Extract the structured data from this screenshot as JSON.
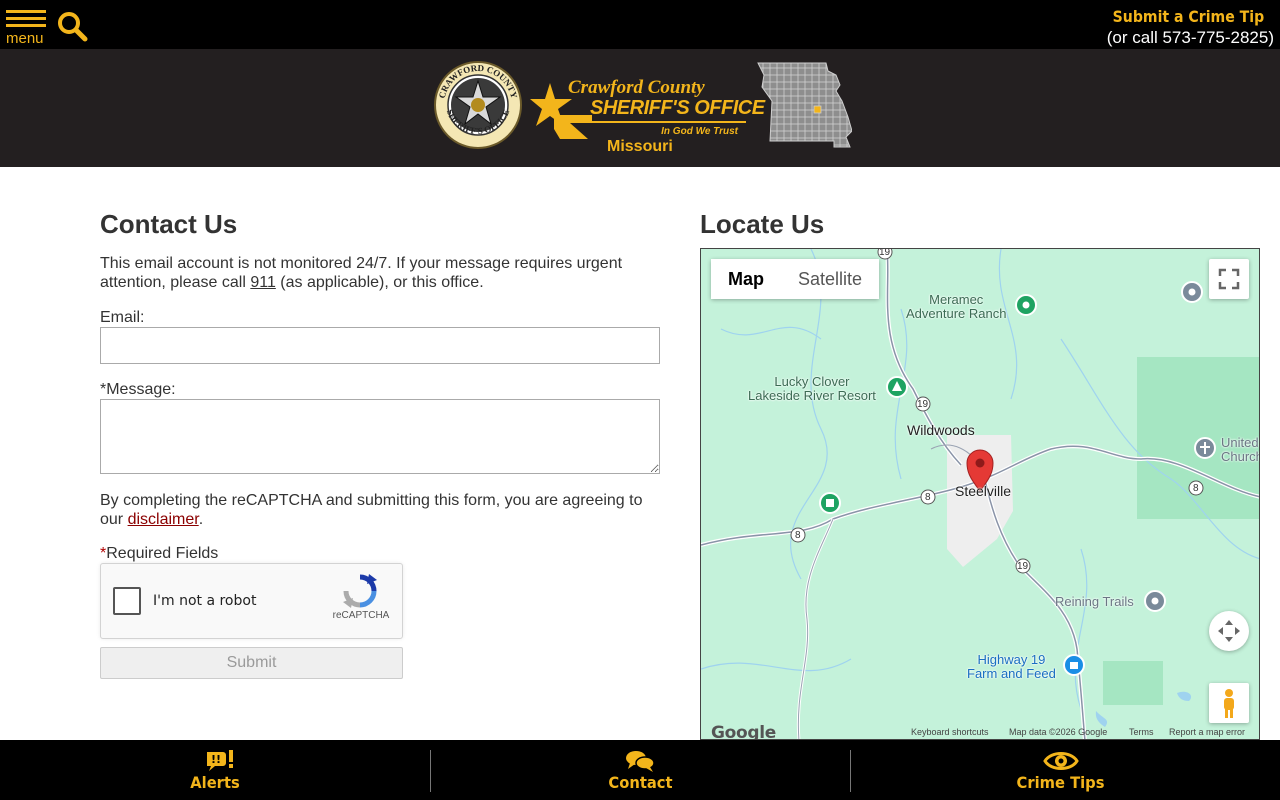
{
  "topbar": {
    "menu_label": "menu",
    "tip_label": "Submit a Crime Tip",
    "tip_phone": "(or call 573-775-2825)"
  },
  "banner": {
    "seal_ring_top": "CRAWFORD COUNTY",
    "seal_ring_bottom": "SHERIFF'S OFFICE",
    "brand_line1": "Crawford County",
    "brand_line2": "SHERIFF'S OFFICE",
    "motto": "In God We Trust",
    "state": "Missouri"
  },
  "contact": {
    "title": "Contact Us",
    "notice_before": "This email account is not monitored 24/7. If your message requires urgent attention, please call ",
    "notice_link": "911",
    "notice_after": " (as applicable), or this office.",
    "email_label": "Email:",
    "email_value": "",
    "message_label": "*Message:",
    "message_value": "",
    "agree_before": "By completing the reCAPTCHA and submitting this form, you are agreeing to our ",
    "agree_link": "disclaimer",
    "agree_after": ".",
    "required_star": "*",
    "required_text": "Required Fields",
    "captcha_text": "I'm not a robot",
    "captcha_brand": "reCAPTCHA",
    "submit_label": "Submit"
  },
  "locate": {
    "title": "Locate Us",
    "map_tab": "Map",
    "satellite_tab": "Satellite",
    "labels": {
      "meramec": "Meramec\nAdventure Ranch",
      "lucky_clover": "Lucky Clover\nLakeside River Resort",
      "wildwoods": "Wildwoods",
      "steelville": "Steelville",
      "united_church": "United\nChurch",
      "reining_trails": "Reining Trails",
      "highway19": "Highway 19\nFarm and Feed",
      "route19": "19",
      "route8": "8"
    },
    "google": "Google",
    "footer": {
      "shortcuts": "Keyboard shortcuts",
      "mapdata": "Map data ©2026 Google",
      "terms": "Terms",
      "report": "Report a map error"
    }
  },
  "bottomnav": {
    "alerts": "Alerts",
    "contact": "Contact",
    "tips": "Crime Tips"
  },
  "colors": {
    "accent": "#f3b51b",
    "topbar_bg": "#000000",
    "banner_bg": "#231f20",
    "map_bg": "#bff0d6"
  }
}
